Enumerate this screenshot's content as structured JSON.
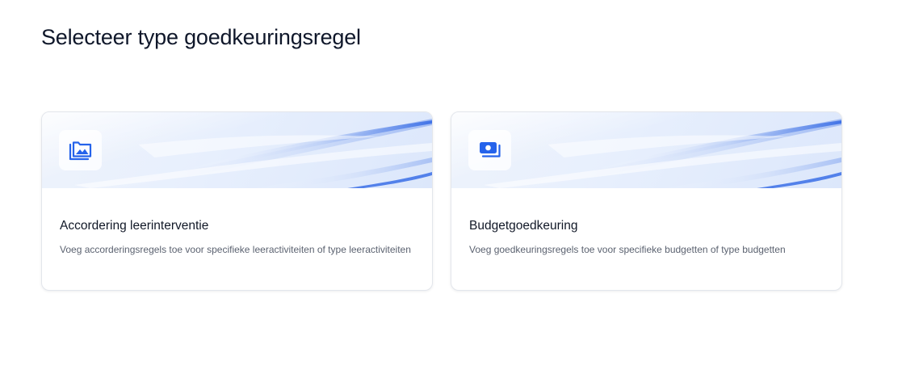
{
  "page": {
    "title": "Selecteer type goedkeuringsregel"
  },
  "cards": [
    {
      "icon": "photo-library-icon",
      "title": "Accordering leerinterventie",
      "description": "Voeg accorderingsregels toe voor specifieke leeractiviteiten of type leeractiviteiten"
    },
    {
      "icon": "money-stack-icon",
      "title": "Budgetgoedkeuring",
      "description": "Voeg goedkeuringsregels toe voor specifieke budgetten of type budgetten"
    }
  ],
  "colors": {
    "accent": "#2563eb",
    "title": "#0f172a",
    "muted": "#5b6270",
    "border": "#e3e6ec"
  }
}
